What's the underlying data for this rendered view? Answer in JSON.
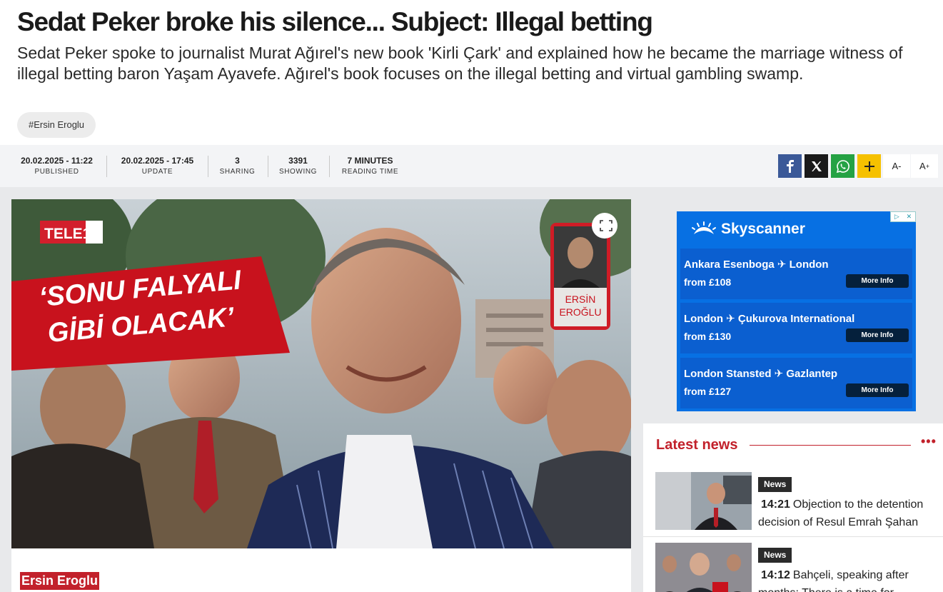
{
  "article": {
    "headline": "Sedat Peker broke his silence... Subject: Illegal betting",
    "spot": "Sedat Peker spoke to journalist Murat Ağırel's new book 'Kirli Çark' and explained how he became the marriage witness of illegal betting baron Yaşam Ayavefe. Ağırel's book focuses on the illegal betting and virtual gambling swamp.",
    "tag": "#Ersin Eroglu",
    "author": "Ersin Eroglu"
  },
  "meta": [
    {
      "value": "20.02.2025 - 11:22",
      "label": "PUBLISHED"
    },
    {
      "value": "20.02.2025 - 17:45",
      "label": "UPDATE"
    },
    {
      "value": "3",
      "label": "SHARING"
    },
    {
      "value": "3391",
      "label": "SHOWING"
    },
    {
      "value": "7 MINUTES",
      "label": "READING TIME"
    }
  ],
  "share": {
    "font_minus": "A-",
    "font_plus": "A",
    "font_plus_sup": "+",
    "colors": {
      "facebook": "#3b5998",
      "x": "#1a1a1a",
      "whatsapp": "#25a244",
      "more": "#f6c100"
    }
  },
  "image": {
    "channel_logo": "TELE1",
    "banner_line1": "‘SONU FALYALI",
    "banner_line2": "GİBİ OLACAK’",
    "author_card_line1": "ERSİN",
    "author_card_line2": "EROĞLU"
  },
  "ad": {
    "brand": "Skyscanner",
    "offers": [
      {
        "route": "Ankara Esenboga ✈ London",
        "price": "from £108",
        "cta": "More Info"
      },
      {
        "route": "London ✈ Çukurova International",
        "price": "from £130",
        "cta": "More Info"
      },
      {
        "route": "London Stansted ✈ Gazlantep",
        "price": "from £127",
        "cta": "More Info"
      }
    ]
  },
  "latest_news": {
    "title": "Latest news",
    "more": "•••",
    "items": [
      {
        "badge": "News",
        "time": "14:21",
        "text": "Objection to the detention decision of Resul Emrah Şahan"
      },
      {
        "badge": "News",
        "time": "14:12",
        "text": "Bahçeli, speaking after months: There is a time for"
      }
    ]
  }
}
